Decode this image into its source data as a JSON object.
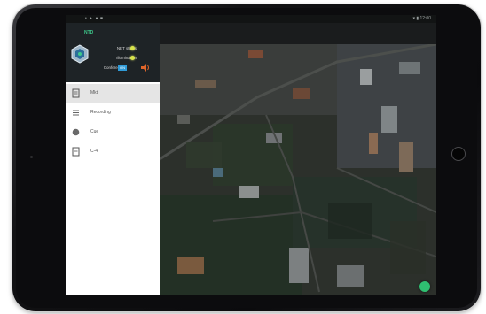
{
  "status_bar": {
    "left": "• ▲ ● ■",
    "right": "▾ ▮ 12:00"
  },
  "drawer": {
    "title": "NTD",
    "rows": [
      {
        "label": "NET status"
      },
      {
        "label": "Illumination"
      },
      {
        "label": "Conference",
        "value": "ON"
      }
    ],
    "items": [
      {
        "label": "Mkt",
        "icon": "document-icon",
        "selected": true
      },
      {
        "label": "Recording",
        "icon": "list-icon",
        "selected": false
      },
      {
        "label": "Cue",
        "icon": "circle-icon",
        "selected": false
      },
      {
        "label": "C-4",
        "icon": "document-icon",
        "selected": false
      }
    ]
  },
  "colors": {
    "accent_green": "#3ec98b",
    "conference_blue": "#2f9ad6",
    "led_yellow": "#d7e34b",
    "speaker_orange": "#e0652a",
    "fab_green": "#2fbf71"
  }
}
